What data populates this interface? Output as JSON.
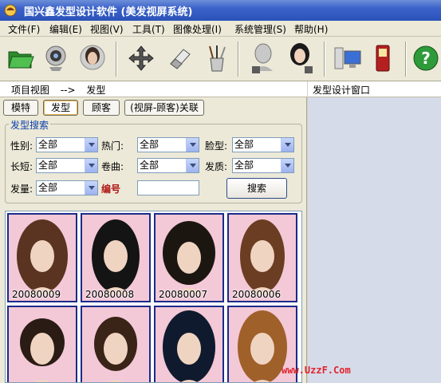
{
  "window": {
    "title": "国兴鑫发型设计软件 (美发视屏系统)"
  },
  "menu": [
    "文件(F)",
    "编辑(E)",
    "视图(V)",
    "工具(T)",
    "图像处理(I)",
    "系统管理(S)",
    "帮助(H)"
  ],
  "toolbar": {
    "buttons": [
      {
        "icon": "open-folder-icon"
      },
      {
        "icon": "webcam-icon"
      },
      {
        "icon": "portrait-icon"
      },
      {
        "icon": "move-icon"
      },
      {
        "icon": "eraser-icon"
      },
      {
        "icon": "brushes-icon"
      },
      {
        "icon": "model-save-icon"
      },
      {
        "icon": "female-save-icon"
      },
      {
        "icon": "computer-icon"
      },
      {
        "icon": "phone-icon"
      },
      {
        "icon": "help-icon"
      }
    ]
  },
  "breadcrumb": {
    "item1": "项目视图",
    "arrow": "-->",
    "item2": "发型"
  },
  "tabs": [
    "模特",
    "发型",
    "顾客",
    "(视屏-顾客)关联"
  ],
  "search": {
    "title": "发型搜索",
    "labels": {
      "gender": "性别:",
      "hot": "热门:",
      "face": "脸型:",
      "length": "长短:",
      "curl": "卷曲:",
      "quality": "发质:",
      "volume": "发量:",
      "code": "编号"
    },
    "values": {
      "gender": "全部",
      "hot": "全部",
      "face": "全部",
      "length": "全部",
      "curl": "全部",
      "quality": "全部",
      "volume": "全部"
    },
    "button": "搜索"
  },
  "gallery": [
    {
      "code": "20080009",
      "hair": "#5a3420"
    },
    {
      "code": "20080008",
      "hair": "#141414"
    },
    {
      "code": "20080007",
      "hair": "#1c1610"
    },
    {
      "code": "20080006",
      "hair": "#6b3d22"
    },
    {
      "code": "",
      "hair": "#2a1c14"
    },
    {
      "code": "",
      "hair": "#3a2418"
    },
    {
      "code": "",
      "hair": "#101a2e"
    },
    {
      "code": "",
      "hair": "#a0602a"
    }
  ],
  "right_panel": {
    "title": "发型设计窗口"
  },
  "watermark": "www.UzzF.Com"
}
